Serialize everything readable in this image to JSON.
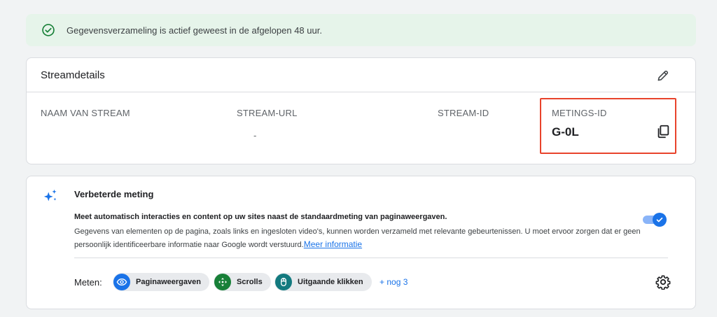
{
  "banner": {
    "text": "Gegevensverzameling is actief geweest in de afgelopen 48 uur.",
    "icon": "check-circle-icon",
    "color": "#188038"
  },
  "stream_details": {
    "title": "Streamdetails",
    "edit_icon": "pencil-icon",
    "columns": {
      "name_label": "NAAM VAN STREAM",
      "url_label": "STREAM-URL",
      "url_value": "-",
      "id_label": "STREAM-ID",
      "measurement_label": "METINGS-ID",
      "measurement_value": "G-0L"
    },
    "copy_icon": "copy-icon",
    "highlight_color": "#e8432b"
  },
  "enhanced": {
    "title": "Verbeterde meting",
    "bold_line": "Meet automatisch interacties en content op uw sites naast de standaardmeting van paginaweergaven.",
    "desc": "Gegevens van elementen op de pagina, zoals links en ingesloten video's, kunnen worden verzameld met relevante gebeurtenissen. U moet ervoor zorgen dat er geen persoonlijk identificeerbare informatie naar Google wordt verstuurd.",
    "link": "Meer informatie",
    "toggle_on": true,
    "measure_label": "Meten:",
    "chips": [
      {
        "label": "Paginaweergaven",
        "icon": "eye-icon",
        "color": "#1a73e8"
      },
      {
        "label": "Scrolls",
        "icon": "scroll-arrows-icon",
        "color": "#188038"
      },
      {
        "label": "Uitgaande klikken",
        "icon": "mouse-icon",
        "color": "#137a7f"
      }
    ],
    "more": "+ nog 3",
    "settings_icon": "gear-icon"
  }
}
